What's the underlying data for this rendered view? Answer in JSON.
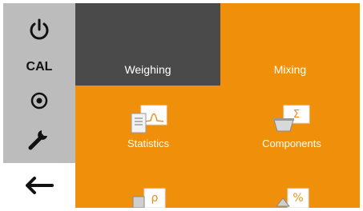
{
  "sidebar": {
    "power_icon": "power-icon",
    "cal_label": "CAL",
    "target_icon": "target-icon",
    "wrench_icon": "wrench-icon",
    "back_icon": "arrow-left-icon"
  },
  "tabs": [
    {
      "label": "Weighing",
      "active": true
    },
    {
      "label": "Mixing",
      "active": false
    }
  ],
  "items": [
    {
      "label": "Statistics",
      "icon": "statistics-icon"
    },
    {
      "label": "Components",
      "icon": "components-icon"
    },
    {
      "label": "",
      "icon": "density-icon"
    },
    {
      "label": "",
      "icon": "percent-icon"
    }
  ],
  "colors": {
    "accent": "#f0900a",
    "active_tab": "#4a4a4a",
    "sidebar": "#bcbcbc"
  }
}
